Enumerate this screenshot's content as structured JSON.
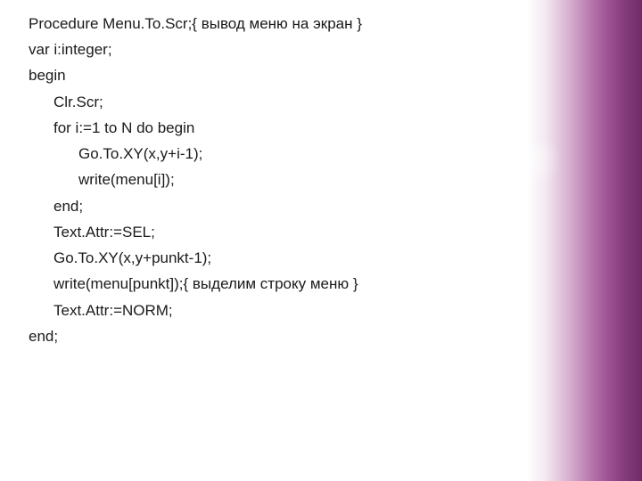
{
  "code": {
    "l01": "Procedure Menu.To.Scr;{ вывод меню на экран }",
    "l02": "var i:integer;",
    "l03": "begin",
    "l04": "Clr.Scr;",
    "l05": "for i:=1 to N do begin",
    "l06": "Go.To.XY(x,y+i-1);",
    "l07": "write(menu[i]);",
    "l08": "end;",
    "l09": "Text.Attr:=SEL;",
    "l10": "Go.To.XY(x,y+punkt-1);",
    "l11": "write(menu[punkt]);{ выделим строку меню }",
    "l12": "Text.Attr:=NORM;",
    "l13": "end;"
  }
}
